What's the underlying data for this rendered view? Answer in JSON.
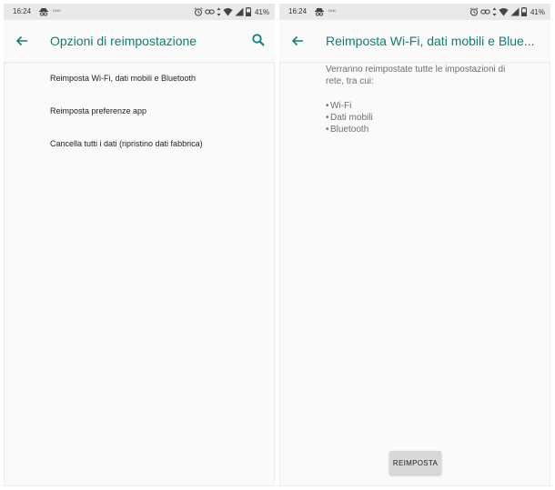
{
  "left_screen": {
    "status_bar": {
      "time": "16:24",
      "dnc": "DNC",
      "battery": "41%"
    },
    "toolbar": {
      "title": "Opzioni di reimpostazione"
    },
    "options": [
      {
        "label": "Reimposta Wi-Fi, dati mobili e Bluetooth"
      },
      {
        "label": "Reimposta preferenze app"
      },
      {
        "label": "Cancella tutti i dati (ripristino dati fabbrica)"
      }
    ]
  },
  "right_screen": {
    "status_bar": {
      "time": "16:24",
      "dnc": "DNC",
      "battery": "41%"
    },
    "toolbar": {
      "title": "Reimposta Wi-Fi, dati mobili e Blue..."
    },
    "description_line1": "Verranno reimpostate tutte le impostazioni di",
    "description_line2": "rete, tra cui:",
    "bullets": [
      "Wi-Fi",
      "Dati mobili",
      "Bluetooth"
    ],
    "reset_button": "REIMPOSTA"
  },
  "colors": {
    "accent": "#0d7f77",
    "status_bar_bg": "#e9e9e9",
    "screen_bg": "#fafafa"
  },
  "icons": [
    "incognito-icon",
    "alarm-icon",
    "link-icon",
    "data-arrows-icon",
    "wifi-icon",
    "signal-icon",
    "battery-icon",
    "back-arrow-icon",
    "search-icon"
  ]
}
